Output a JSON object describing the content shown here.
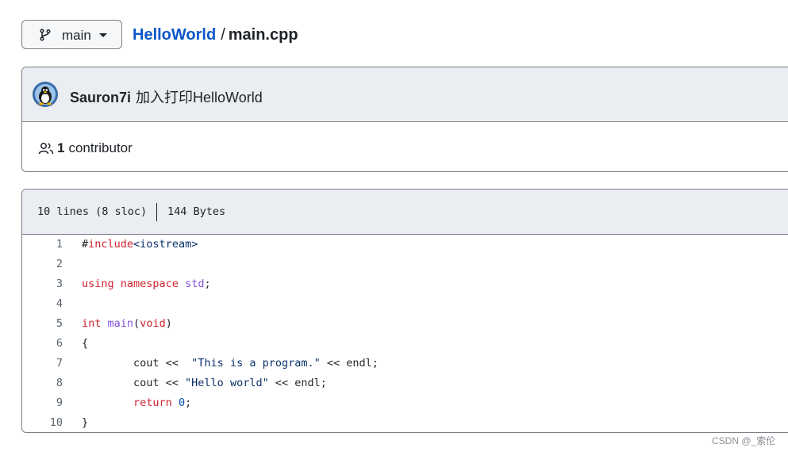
{
  "branch": {
    "label": "main"
  },
  "breadcrumb": {
    "repo": "HelloWorld",
    "separator": "/",
    "file": "main.cpp"
  },
  "commit": {
    "author": "Sauron7i",
    "message": "加入打印HelloWorld"
  },
  "contributors": {
    "count": "1",
    "label": "contributor"
  },
  "file_info": {
    "lines": "10 lines (8 sloc)",
    "size": "144 Bytes"
  },
  "code": {
    "line_numbers": [
      "1",
      "2",
      "3",
      "4",
      "5",
      "6",
      "7",
      "8",
      "9",
      "10"
    ],
    "lines": [
      [
        {
          "t": "#",
          "c": "plain"
        },
        {
          "t": "include",
          "c": "kw"
        },
        {
          "t": "<iostream>",
          "c": "str"
        }
      ],
      [],
      [
        {
          "t": "using",
          "c": "kw"
        },
        {
          "t": " ",
          "c": "plain"
        },
        {
          "t": "namespace",
          "c": "kw"
        },
        {
          "t": " ",
          "c": "plain"
        },
        {
          "t": "std",
          "c": "ent"
        },
        {
          "t": ";",
          "c": "plain"
        }
      ],
      [],
      [
        {
          "t": "int",
          "c": "kw"
        },
        {
          "t": " ",
          "c": "plain"
        },
        {
          "t": "main",
          "c": "ent"
        },
        {
          "t": "(",
          "c": "plain"
        },
        {
          "t": "void",
          "c": "kw"
        },
        {
          "t": ")",
          "c": "plain"
        }
      ],
      [
        {
          "t": "{",
          "c": "plain"
        }
      ],
      [
        {
          "t": "        cout << ",
          "c": "plain"
        },
        {
          "t": " \"This is a program.\"",
          "c": "str"
        },
        {
          "t": " << endl;",
          "c": "plain"
        }
      ],
      [
        {
          "t": "        cout << ",
          "c": "plain"
        },
        {
          "t": "\"Hello world\"",
          "c": "str"
        },
        {
          "t": " << endl;",
          "c": "plain"
        }
      ],
      [
        {
          "t": "        ",
          "c": "plain"
        },
        {
          "t": "return",
          "c": "kw"
        },
        {
          "t": " ",
          "c": "plain"
        },
        {
          "t": "0",
          "c": "num"
        },
        {
          "t": ";",
          "c": "plain"
        }
      ],
      [
        {
          "t": "}",
          "c": "plain"
        }
      ]
    ]
  },
  "watermark": "CSDN @_索伦",
  "icons": {
    "branch": "git-branch-icon",
    "caret": "caret-down-icon",
    "people": "people-icon",
    "avatar": "tux-avatar"
  }
}
